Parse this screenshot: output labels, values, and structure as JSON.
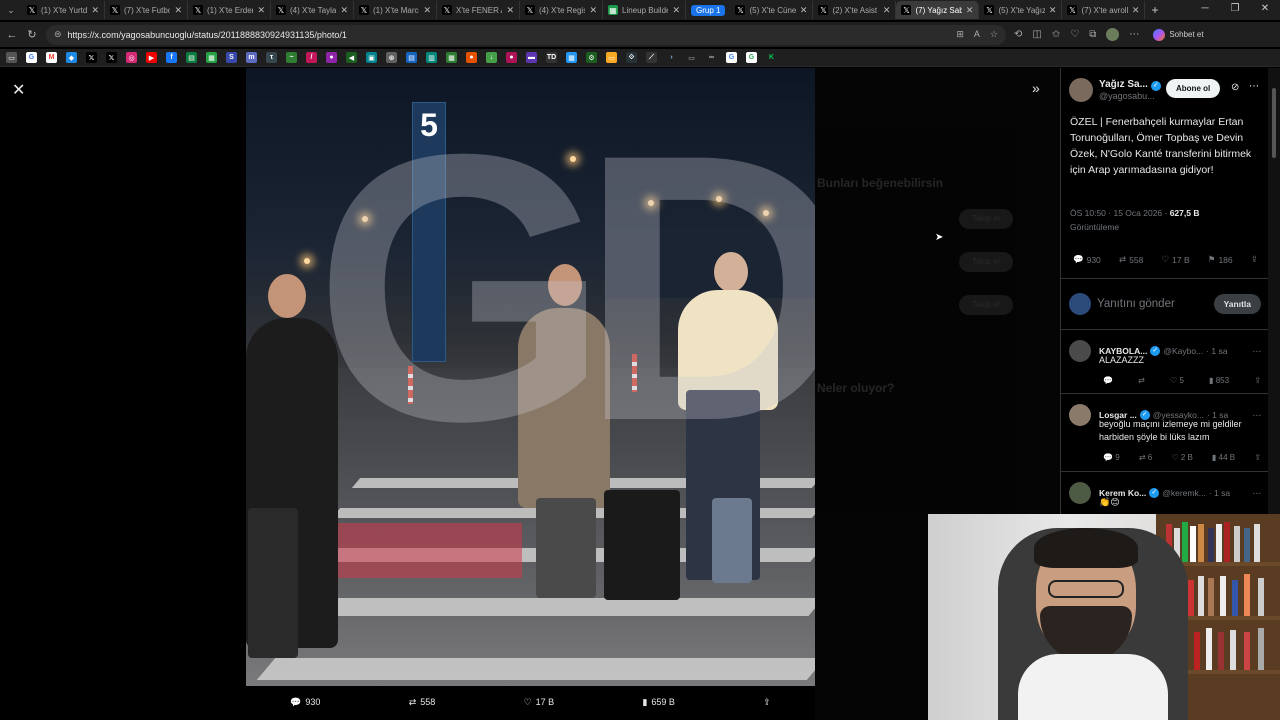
{
  "browser": {
    "tabs": [
      {
        "label": "(1) X'te Yurtd",
        "icon": "x-logo-icon"
      },
      {
        "label": "(7) X'te Futbol",
        "icon": "x-logo-icon"
      },
      {
        "label": "(1) X'te Erdem",
        "icon": "x-logo-icon"
      },
      {
        "label": "(4) X'te Taylan",
        "icon": "x-logo-icon"
      },
      {
        "label": "(1) X'te Marco",
        "icon": "x-logo-icon"
      },
      {
        "label": "X'te FENER AC",
        "icon": "x-logo-icon"
      },
      {
        "label": "(4) X'te Regist",
        "icon": "x-logo-icon"
      },
      {
        "label": "Lineup Builder",
        "icon": "lineup-builder-icon"
      },
      {
        "label": "(5) X'te Cüney",
        "icon": "x-logo-icon"
      },
      {
        "label": "(2) X'te Asist A",
        "icon": "x-logo-icon"
      },
      {
        "label": "(7) Yağız Sabu",
        "icon": "x-logo-icon",
        "active": true
      },
      {
        "label": "(5) X'te Yağız",
        "icon": "x-logo-icon"
      },
      {
        "label": "(7) X'te avroll",
        "icon": "x-logo-icon"
      }
    ],
    "group_label": "Grup 1",
    "new_tab": "+",
    "url": "https://x.com/yagosabuncuoglu/status/2011888830924931135/photo/1",
    "copilot_label": "Sohbet et",
    "accent": "#1a73e8"
  },
  "viewer": {
    "watermark": "GD",
    "gate_sign": "5",
    "bottom_actions": {
      "replies": "930",
      "reposts": "558",
      "likes": "17 B",
      "views": "659 B"
    }
  },
  "tweet": {
    "author_name": "Yağız Sa...",
    "author_handle": "@yagosabu...",
    "subscribe_label": "Abone ol",
    "text": "ÖZEL | Fenerbahçeli kurmaylar Ertan Torunoğulları, Ömer Topbaş ve Devin Özek, N'Golo Kanté transferini bitirmek için Arap yarımadasına gidiyor!",
    "time": "ÖS 10:50 · 15 Oca 2026 · ",
    "views_count": "627,5 B",
    "views_label": "Görüntüleme",
    "stats": {
      "replies": "930",
      "reposts": "558",
      "likes": "17 B",
      "bookmarks": "186"
    },
    "reply_placeholder": "Yanıtını gönder",
    "reply_button": "Yanıtla",
    "verified_color": "#1d9bf0"
  },
  "replies": [
    {
      "name": "KAYBOLA...",
      "handle": "@Kaybo...",
      "time": "· 1 sa",
      "text": "ALAZAZZZ",
      "replies": "",
      "reposts": "",
      "likes": "5",
      "views": "853"
    },
    {
      "name": "Losgar ...",
      "handle": "@yessayko...",
      "time": "· 1 sa",
      "text": "beyoğlu maçını izlemeye mi geldiler harbiden şöyle bi lüks lazım",
      "replies": "9",
      "reposts": "6",
      "likes": "2 B",
      "views": "44 B"
    },
    {
      "name": "Kerem Ko...",
      "handle": "@keremk...",
      "time": "· 1 sa",
      "text": "👏😊",
      "replies": "",
      "reposts": "",
      "likes": "",
      "views": ""
    }
  ],
  "background_page": {
    "heading": "Bunları beğenebilirsin",
    "heading2": "Neler oluyor?",
    "follow_label": "Takip et"
  }
}
